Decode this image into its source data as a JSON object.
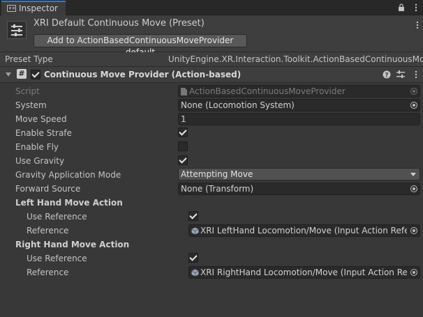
{
  "tab": {
    "label": "Inspector",
    "icon": "inspector-icon"
  },
  "header": {
    "title": "XRI Default Continuous Move (Preset)",
    "button_label": "Add to ActionBasedContinuousMoveProvider default"
  },
  "preset_type": {
    "label": "Preset Type",
    "value": "UnityEngine.XR.Interaction.Toolkit.ActionBasedContinuousMove"
  },
  "component": {
    "name": "Continuous Move Provider (Action-based)",
    "enabled": true
  },
  "properties": {
    "script": {
      "label": "Script",
      "value": "ActionBasedContinuousMoveProvider"
    },
    "system": {
      "label": "System",
      "value": "None (Locomotion System)"
    },
    "move_speed": {
      "label": "Move Speed",
      "value": "1"
    },
    "enable_strafe": {
      "label": "Enable Strafe",
      "checked": true
    },
    "enable_fly": {
      "label": "Enable Fly",
      "checked": false
    },
    "use_gravity": {
      "label": "Use Gravity",
      "checked": true
    },
    "gravity_mode": {
      "label": "Gravity Application Mode",
      "value": "Attempting Move"
    },
    "forward_source": {
      "label": "Forward Source",
      "value": "None (Transform)"
    },
    "left_hand": {
      "header": "Left Hand Move Action",
      "use_reference_label": "Use Reference",
      "use_reference": true,
      "reference_label": "Reference",
      "reference_value": "XRI LeftHand Locomotion/Move (Input Action Reference)"
    },
    "right_hand": {
      "header": "Right Hand Move Action",
      "use_reference_label": "Use Reference",
      "use_reference": true,
      "reference_label": "Reference",
      "reference_value": "XRI RightHand Locomotion/Move (Input Action Reference)"
    }
  },
  "colors": {
    "tab_accent": "#3a79bb",
    "panel_bg": "#383838",
    "field_bg": "#2a2a2a"
  }
}
